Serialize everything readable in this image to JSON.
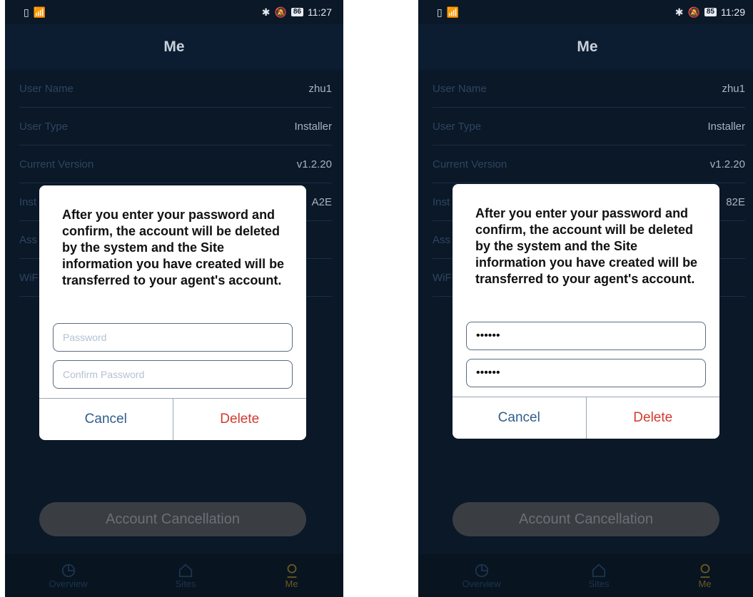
{
  "screens": [
    {
      "status": {
        "time": "11:27",
        "battery": "86"
      },
      "header_title": "Me",
      "rows": [
        {
          "label": "User Name",
          "value": "zhu1"
        },
        {
          "label": "User Type",
          "value": "Installer"
        },
        {
          "label": "Current Version",
          "value": "v1.2.20"
        },
        {
          "label": "Inst",
          "value": "A2E"
        },
        {
          "label": "Ass",
          "value": ""
        },
        {
          "label": "WiF",
          "value": ""
        }
      ],
      "dialog": {
        "message": "After you enter your password and confirm, the account will be deleted by the system and the Site information you have created will be transferred to your agent's account.",
        "password_placeholder": "Password",
        "password_value": "",
        "confirm_placeholder": "Confirm Password",
        "confirm_value": "",
        "cancel_label": "Cancel",
        "delete_label": "Delete"
      },
      "account_button": "Account Cancellation",
      "tabs": [
        {
          "label": "Overview",
          "icon": "pie-chart-icon"
        },
        {
          "label": "Sites",
          "icon": "home-icon"
        },
        {
          "label": "Me",
          "icon": "user-icon"
        }
      ]
    },
    {
      "status": {
        "time": "11:29",
        "battery": "85"
      },
      "header_title": "Me",
      "rows": [
        {
          "label": "User Name",
          "value": "zhu1"
        },
        {
          "label": "User Type",
          "value": "Installer"
        },
        {
          "label": "Current Version",
          "value": "v1.2.20"
        },
        {
          "label": "Inst",
          "value": "82E"
        },
        {
          "label": "Ass",
          "value": ""
        },
        {
          "label": "WiF",
          "value": ""
        }
      ],
      "dialog": {
        "message": "After you enter your password and confirm, the account will be deleted by the system and the Site information you have created will be transferred to your agent's account.",
        "password_placeholder": "",
        "password_value": "••••••",
        "confirm_placeholder": "",
        "confirm_value": "••••••",
        "cancel_label": "Cancel",
        "delete_label": "Delete"
      },
      "account_button": "Account Cancellation",
      "tabs": [
        {
          "label": "Overview",
          "icon": "pie-chart-icon"
        },
        {
          "label": "Sites",
          "icon": "home-icon"
        },
        {
          "label": "Me",
          "icon": "user-icon"
        }
      ]
    }
  ]
}
